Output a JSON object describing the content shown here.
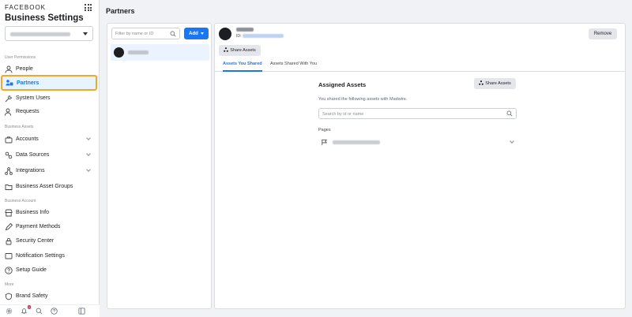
{
  "sidebar": {
    "brand": "FACEBOOK",
    "title": "Business Settings",
    "sections": {
      "users": "User Permissions",
      "assets": "Business Assets",
      "account": "Business Account",
      "more": "More"
    },
    "items": {
      "people": "People",
      "partners": "Partners",
      "system_users": "System Users",
      "requests": "Requests",
      "accounts": "Accounts",
      "data_sources": "Data Sources",
      "integrations": "Integrations",
      "asset_groups": "Business Asset Groups",
      "business_info": "Business Info",
      "payment_methods": "Payment Methods",
      "security_center": "Security Center",
      "notification_settings": "Notification Settings",
      "setup_guide": "Setup Guide",
      "brand_safety": "Brand Safety"
    },
    "notification_badge": "2"
  },
  "main": {
    "title": "Partners",
    "filter_placeholder": "Filter by name or ID",
    "add_label": "Add"
  },
  "detail": {
    "id_label": "ID:",
    "remove_label": "Remove",
    "share_label": "Share Assets",
    "tabs": [
      "Assets You Shared",
      "Assets Shared With You"
    ],
    "assigned_title": "Assigned Assets",
    "assigned_desc": "You shared the following assets with Madwire.",
    "search_placeholder": "Search by id or name",
    "pages_label": "Pages"
  },
  "colors": {
    "accent": "#1877f2",
    "highlight": "#f5a623",
    "active_bg": "#e7f3ff"
  }
}
